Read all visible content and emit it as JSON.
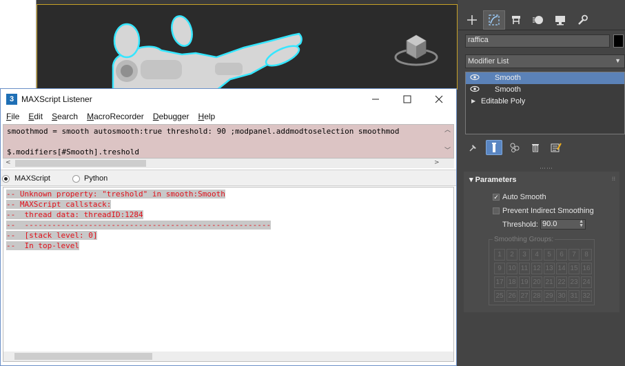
{
  "listener": {
    "title": "MAXScript Listener",
    "icon_label": "3",
    "window_buttons": [
      "minimize-icon",
      "maximize-icon",
      "close-icon"
    ],
    "menu": [
      "File",
      "Edit",
      "Search",
      "MacroRecorder",
      "Debugger",
      "Help"
    ],
    "macro_lines": [
      "smoothmod = smooth autosmooth:true threshold: 90 ;modpanel.addmodtoselection smoothmod",
      "$.modifiers[#Smooth].treshold"
    ],
    "languages": [
      {
        "label": "MAXScript",
        "selected": true
      },
      {
        "label": "Python",
        "selected": false
      }
    ],
    "output_lines": [
      "-- Unknown property: \"treshold\" in smooth:Smooth",
      "-- MAXScript callstack:",
      "--  thread data: threadID:1284",
      "--  ------------------------------------------------------",
      "--  [stack level: 0]",
      "--  In top-level"
    ],
    "output_color": "#e0101a",
    "macro_bg": "#dcc4c4"
  },
  "command_panel": {
    "tabs": [
      "create-icon",
      "modify-icon",
      "hierarchy-icon",
      "motion-icon",
      "display-icon",
      "utilities-icon"
    ],
    "active_tab": "modify-icon",
    "object_name": "raffica",
    "object_color": "#000000",
    "modifier_list_label": "Modifier List",
    "stack": [
      {
        "label": "Smooth",
        "selected": true,
        "visible": true
      },
      {
        "label": "Smooth",
        "selected": false,
        "visible": true
      },
      {
        "label": "Editable Poly",
        "selected": false,
        "expandable": true
      }
    ],
    "stack_buttons": [
      "pin-stack-icon",
      "show-end-result-icon",
      "make-unique-icon",
      "remove-modifier-icon",
      "configure-modifier-sets-icon"
    ],
    "parameters": {
      "title": "Parameters",
      "auto_smooth": {
        "label": "Auto Smooth",
        "checked": true
      },
      "prevent_indirect": {
        "label": "Prevent Indirect Smoothing",
        "checked": false
      },
      "threshold_label": "Threshold:",
      "threshold_value": "90.0",
      "smoothing_groups_label": "Smoothing Groups:",
      "smoothing_groups": [
        "1",
        "2",
        "3",
        "4",
        "5",
        "6",
        "7",
        "8",
        "9",
        "10",
        "11",
        "12",
        "13",
        "14",
        "15",
        "16",
        "17",
        "18",
        "19",
        "20",
        "21",
        "22",
        "23",
        "24",
        "25",
        "26",
        "27",
        "28",
        "29",
        "30",
        "31",
        "32"
      ]
    },
    "selection_color": "#5b82b8"
  }
}
